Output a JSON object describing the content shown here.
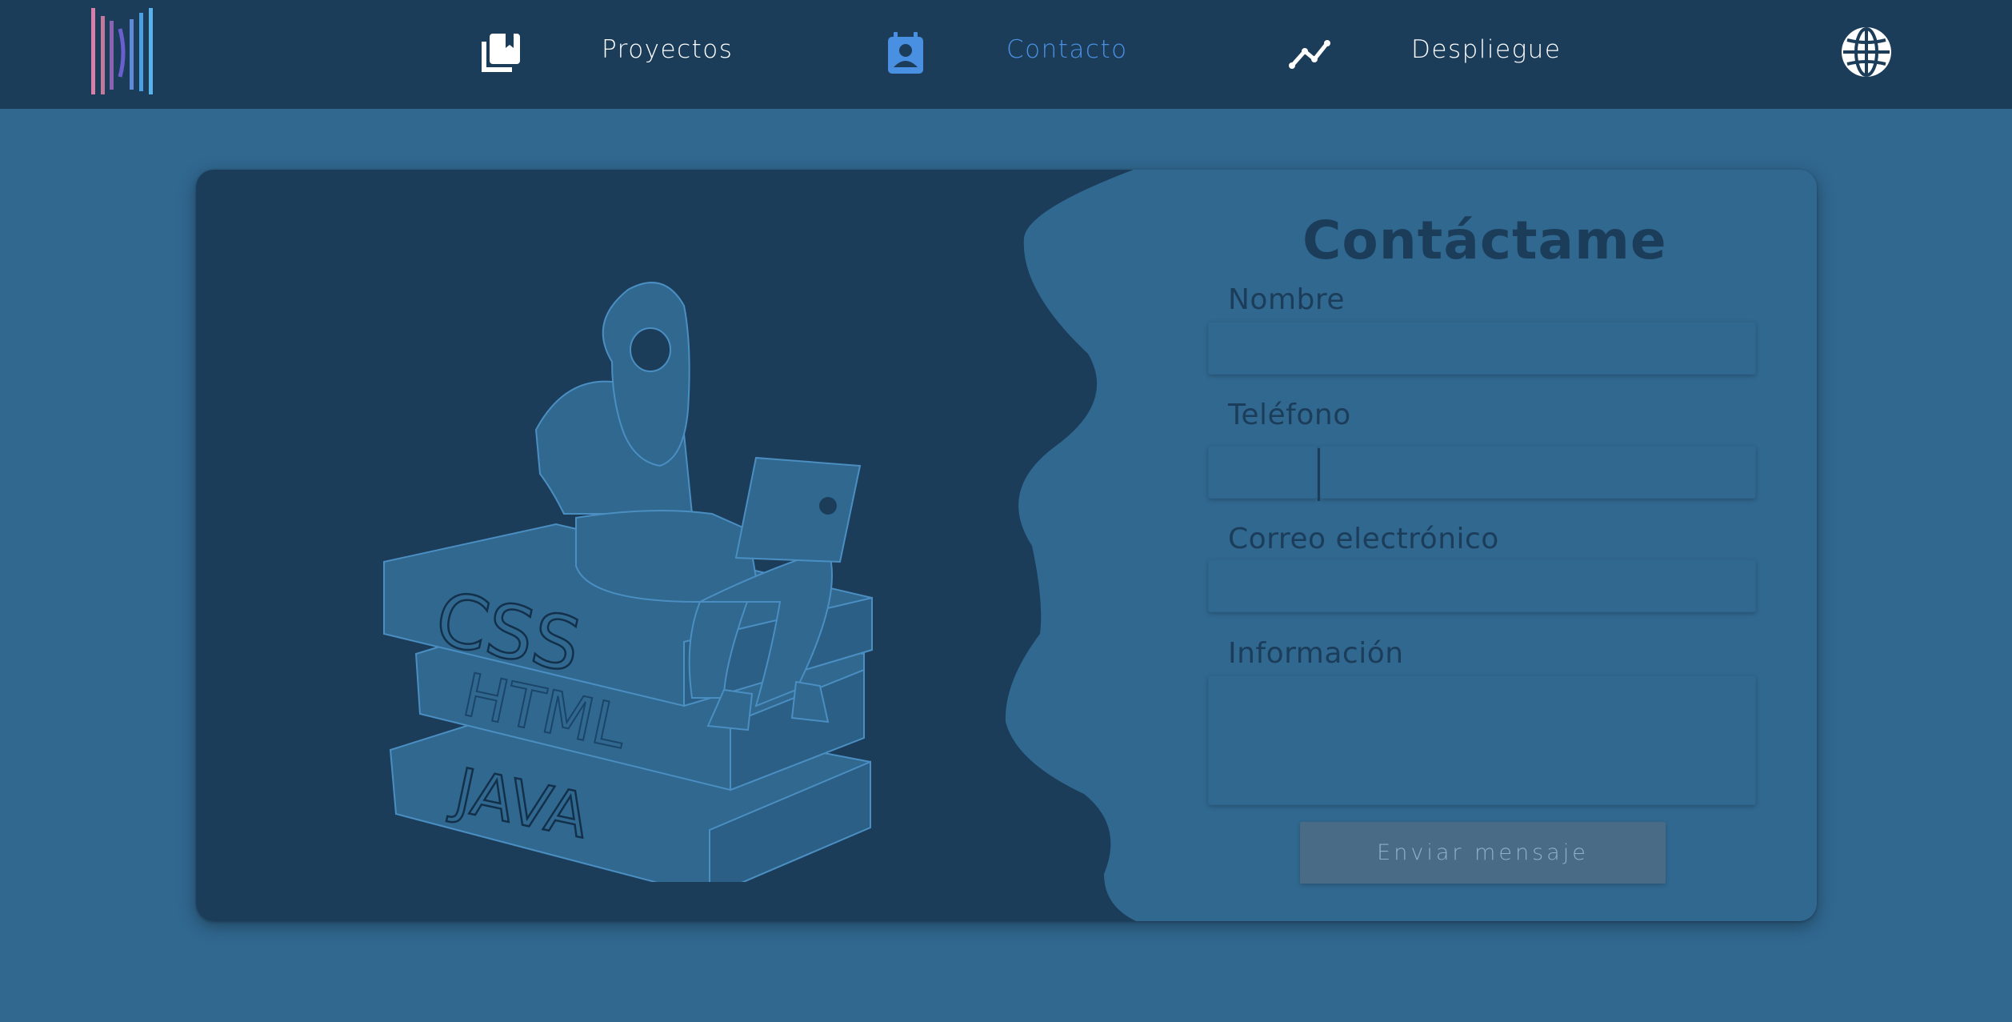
{
  "nav": {
    "items": [
      {
        "label": "Proyectos",
        "icon": "book-stack-icon"
      },
      {
        "label": "Contacto",
        "icon": "contact-card-icon",
        "active": true
      },
      {
        "label": "Despliegue",
        "icon": "trend-line-icon"
      }
    ],
    "language_icon": "globe-icon"
  },
  "illustration": {
    "books": [
      "CSS",
      "HTML",
      "JAVA"
    ]
  },
  "form": {
    "title": "Contáctame",
    "fields": [
      {
        "label": "Nombre",
        "value": ""
      },
      {
        "label": "Teléfono",
        "value": ""
      },
      {
        "label": "Correo electrónico",
        "value": ""
      },
      {
        "label": "Información",
        "value": ""
      }
    ],
    "submit_label": "Enviar mensaje"
  },
  "colors": {
    "navbar": "#1c3d5a",
    "background": "#316890",
    "active_link": "#4a90e2",
    "dark_panel": "#1c3d5a",
    "button": "#4a6b86"
  }
}
